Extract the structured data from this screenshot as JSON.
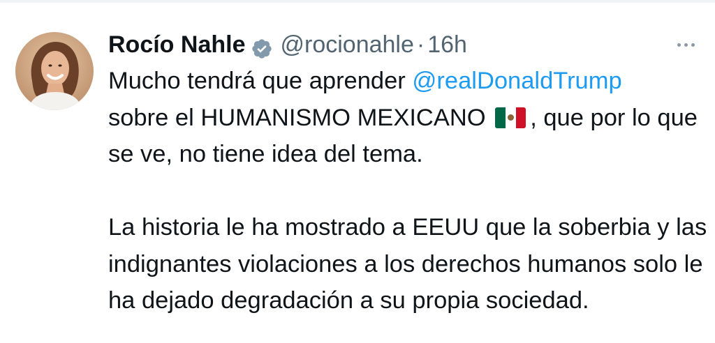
{
  "tweet": {
    "author": {
      "display_name": "Rocío Nahle",
      "handle": "@rocionahle",
      "separator": "·",
      "time": "16h",
      "verified": true
    },
    "body": {
      "line1_text": "Mucho tendrá que aprender ",
      "mention": "@realDonaldTrump",
      "line2_text": "sobre el HUMANISMO MEXICANO",
      "flag_icon": "mexico-flag",
      "line2_rest": ", que por lo que se ve, no tiene idea del tema.",
      "paragraph2": "La historia le ha mostrado a EEUU  que la soberbia y las indignantes violaciones a los derechos humanos solo le ha dejado degradación a su propia sociedad."
    }
  },
  "colors": {
    "link": "#1d9bf0",
    "text_primary": "#0f1419",
    "text_secondary": "#536471",
    "verified_badge": "#829aab"
  },
  "icons": {
    "verified": "verified-badge-icon",
    "more": "more-options-icon",
    "flag": "mexico-flag-icon"
  }
}
